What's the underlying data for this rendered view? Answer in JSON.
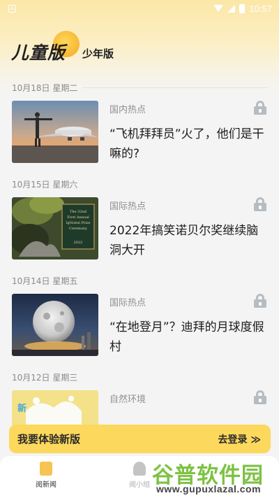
{
  "status_bar": {
    "time": "10:57",
    "app_icon_letter": "A"
  },
  "header": {
    "logo_title": "儿童版",
    "logo_subtitle": "少年版"
  },
  "feed": [
    {
      "date": "10月18日 星期二",
      "category": "国内热点",
      "title": "“飞机拜拜员”火了，他们是干嘛的?",
      "image": "airplane-photo",
      "locked": true
    },
    {
      "date": "10月15日 星期六",
      "category": "国际热点",
      "title": "2022年搞笑诺贝尔奖继续脑洞大开",
      "image": "ig-nobel-book-photo",
      "locked": true
    },
    {
      "date": "10月14日 星期五",
      "category": "国际热点",
      "title": "“在地登月”？迪拜的月球度假村",
      "image": "moon-resort-photo",
      "locked": true
    },
    {
      "date": "10月12日 星期三",
      "category": "自然环境",
      "title": "",
      "image": "milk-splash-photo",
      "locked": true
    }
  ],
  "promo": {
    "text": "我要体验新版",
    "login": "去登录 ≫"
  },
  "tabbar": {
    "tab1": "阅新闻",
    "tab2": "阅小组"
  },
  "watermark": {
    "big": "谷普软件园",
    "small": "www.gupuxlazal.com"
  },
  "colors": {
    "accent": "#fcd85d",
    "header": "#fbe7a6",
    "lock": "#b5bcc2",
    "watermark": "#7dc243"
  }
}
